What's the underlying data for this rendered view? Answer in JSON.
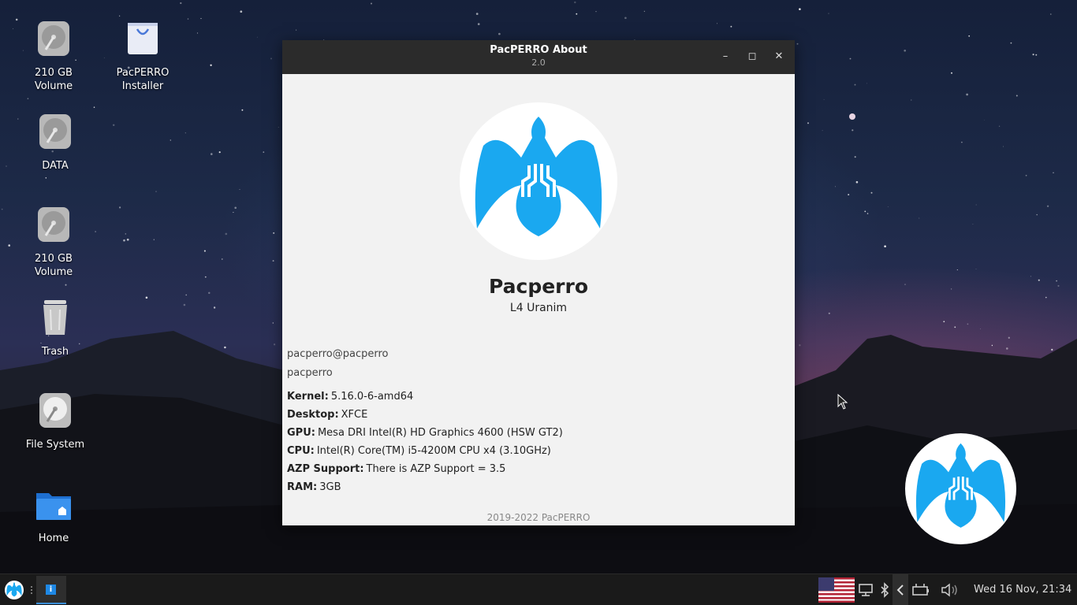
{
  "desktop": {
    "icons": [
      {
        "name": "volume-1",
        "label": "210 GB\nVolume",
        "icon": "hard-drive-icon"
      },
      {
        "name": "installer",
        "label": "PacPERRO\nInstaller",
        "icon": "shopping-bag-icon"
      },
      {
        "name": "data",
        "label": "DATA",
        "icon": "hard-drive-icon"
      },
      {
        "name": "volume-2",
        "label": "210 GB\nVolume",
        "icon": "hard-drive-icon"
      },
      {
        "name": "trash",
        "label": "Trash",
        "icon": "trash-icon"
      },
      {
        "name": "file-system",
        "label": "File System",
        "icon": "hard-drive-icon"
      },
      {
        "name": "home",
        "label": "Home",
        "icon": "home-folder-icon"
      }
    ]
  },
  "window": {
    "title": "PacPERRO About",
    "subtitle": "2.0",
    "minimize_label": "–",
    "maximize_label": "◻",
    "close_label": "✕",
    "distro_name": "Pacperro",
    "distro_version": "L4 Uranim",
    "user_host": "pacperro@pacperro",
    "username": "pacperro",
    "info": [
      {
        "key": "Kernel:",
        "value": "5.16.0-6-amd64"
      },
      {
        "key": "Desktop:",
        "value": "XFCE"
      },
      {
        "key": "GPU:",
        "value": "Mesa DRI Intel(R) HD Graphics 4600 (HSW GT2)"
      },
      {
        "key": "CPU:",
        "value": "Intel(R) Core(TM) i5-4200M CPU x4 (3.10GHz)"
      },
      {
        "key": "AZP Support:",
        "value": "There is AZP Support = 3.5"
      },
      {
        "key": "RAM:",
        "value": "3GB"
      }
    ],
    "copyright": "2019-2022 PacPERRO"
  },
  "panel": {
    "task_icon_label": "i",
    "clock": "Wed 16 Nov, 21:34",
    "tray_icons": [
      "network-icon",
      "bluetooth-icon",
      "collapse-arrow-icon",
      "battery-icon",
      "volume-icon"
    ]
  },
  "colors": {
    "accent": "#1aa8f0",
    "titlebar": "#2b2b2b",
    "panel": "#1a1a1a"
  }
}
